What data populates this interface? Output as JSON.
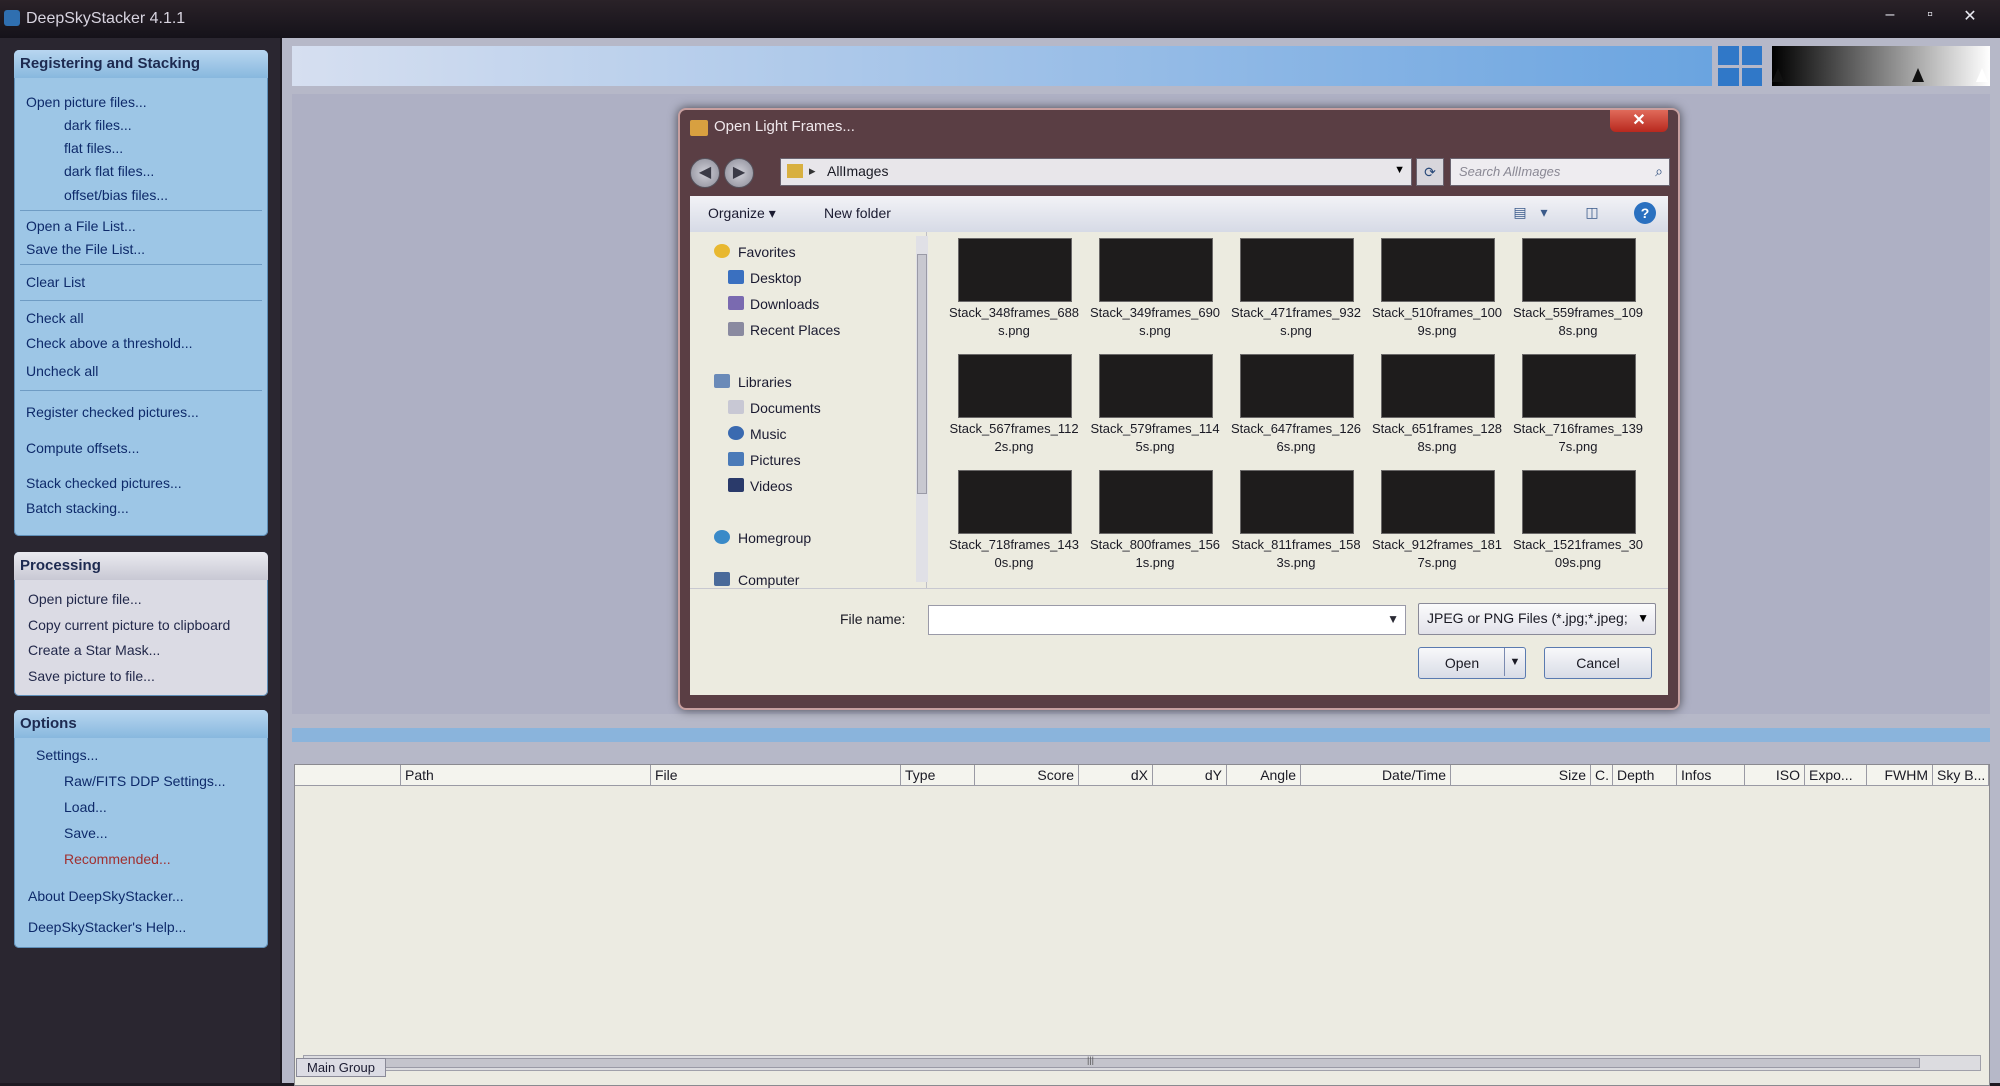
{
  "app": {
    "title": "DeepSkyStacker 4.1.1",
    "controls": {
      "minimize": "–",
      "maximize": "▫",
      "close": "✕"
    }
  },
  "sidebar": {
    "registering": {
      "header": "Registering and Stacking",
      "items": [
        "Open picture files...",
        "dark files...",
        "flat files...",
        "dark flat files...",
        "offset/bias files...",
        "Open a File List...",
        "Save the File List...",
        "Clear List",
        "Check all",
        "Check above a threshold...",
        "Uncheck all",
        "Register checked pictures...",
        "Compute offsets...",
        "Stack checked pictures...",
        "Batch stacking..."
      ]
    },
    "processing": {
      "header": "Processing",
      "items": [
        "Open picture file...",
        "Copy current picture to clipboard",
        "Create a Star Mask...",
        "Save picture to file..."
      ]
    },
    "options": {
      "header": "Options",
      "items": [
        "Settings...",
        "Raw/FITS DDP Settings...",
        "Load...",
        "Save...",
        "Recommended...",
        "About DeepSkyStacker...",
        "DeepSkyStacker's Help..."
      ]
    }
  },
  "filelist": {
    "columns": [
      "Path",
      "File",
      "Type",
      "Score",
      "dX",
      "dY",
      "Angle",
      "Date/Time",
      "Size",
      "C.",
      "Depth",
      "Infos",
      "ISO",
      "Expo...",
      "FWHM",
      "Sky B..."
    ],
    "scroll_mark": "|||",
    "tab": "Main Group"
  },
  "dialog": {
    "title": "Open Light Frames...",
    "close": "✕",
    "address": {
      "sep": "▸",
      "folder": "AllImages"
    },
    "search_placeholder": "Search AllImages",
    "toolbar": {
      "organize": "Organize ▾",
      "new_folder": "New folder",
      "help": "?"
    },
    "nav": {
      "favorites": "Favorites",
      "desktop": "Desktop",
      "downloads": "Downloads",
      "recent": "Recent Places",
      "libraries": "Libraries",
      "documents": "Documents",
      "music": "Music",
      "pictures": "Pictures",
      "videos": "Videos",
      "homegroup": "Homegroup",
      "computer": "Computer"
    },
    "files": [
      "Stack_348frames_688s.png",
      "Stack_349frames_690s.png",
      "Stack_471frames_932s.png",
      "Stack_510frames_1009s.png",
      "Stack_559frames_1098s.png",
      "Stack_567frames_1122s.png",
      "Stack_579frames_1145s.png",
      "Stack_647frames_1266s.png",
      "Stack_651frames_1288s.png",
      "Stack_716frames_1397s.png",
      "Stack_718frames_1430s.png",
      "Stack_800frames_1561s.png",
      "Stack_811frames_1583s.png",
      "Stack_912frames_1817s.png",
      "Stack_1521frames_3009s.png"
    ],
    "file_name_label": "File name:",
    "file_name_value": "",
    "file_type": "JPEG or PNG Files (*.jpg;*.jpeg;*",
    "open": "Open",
    "cancel": "Cancel"
  }
}
